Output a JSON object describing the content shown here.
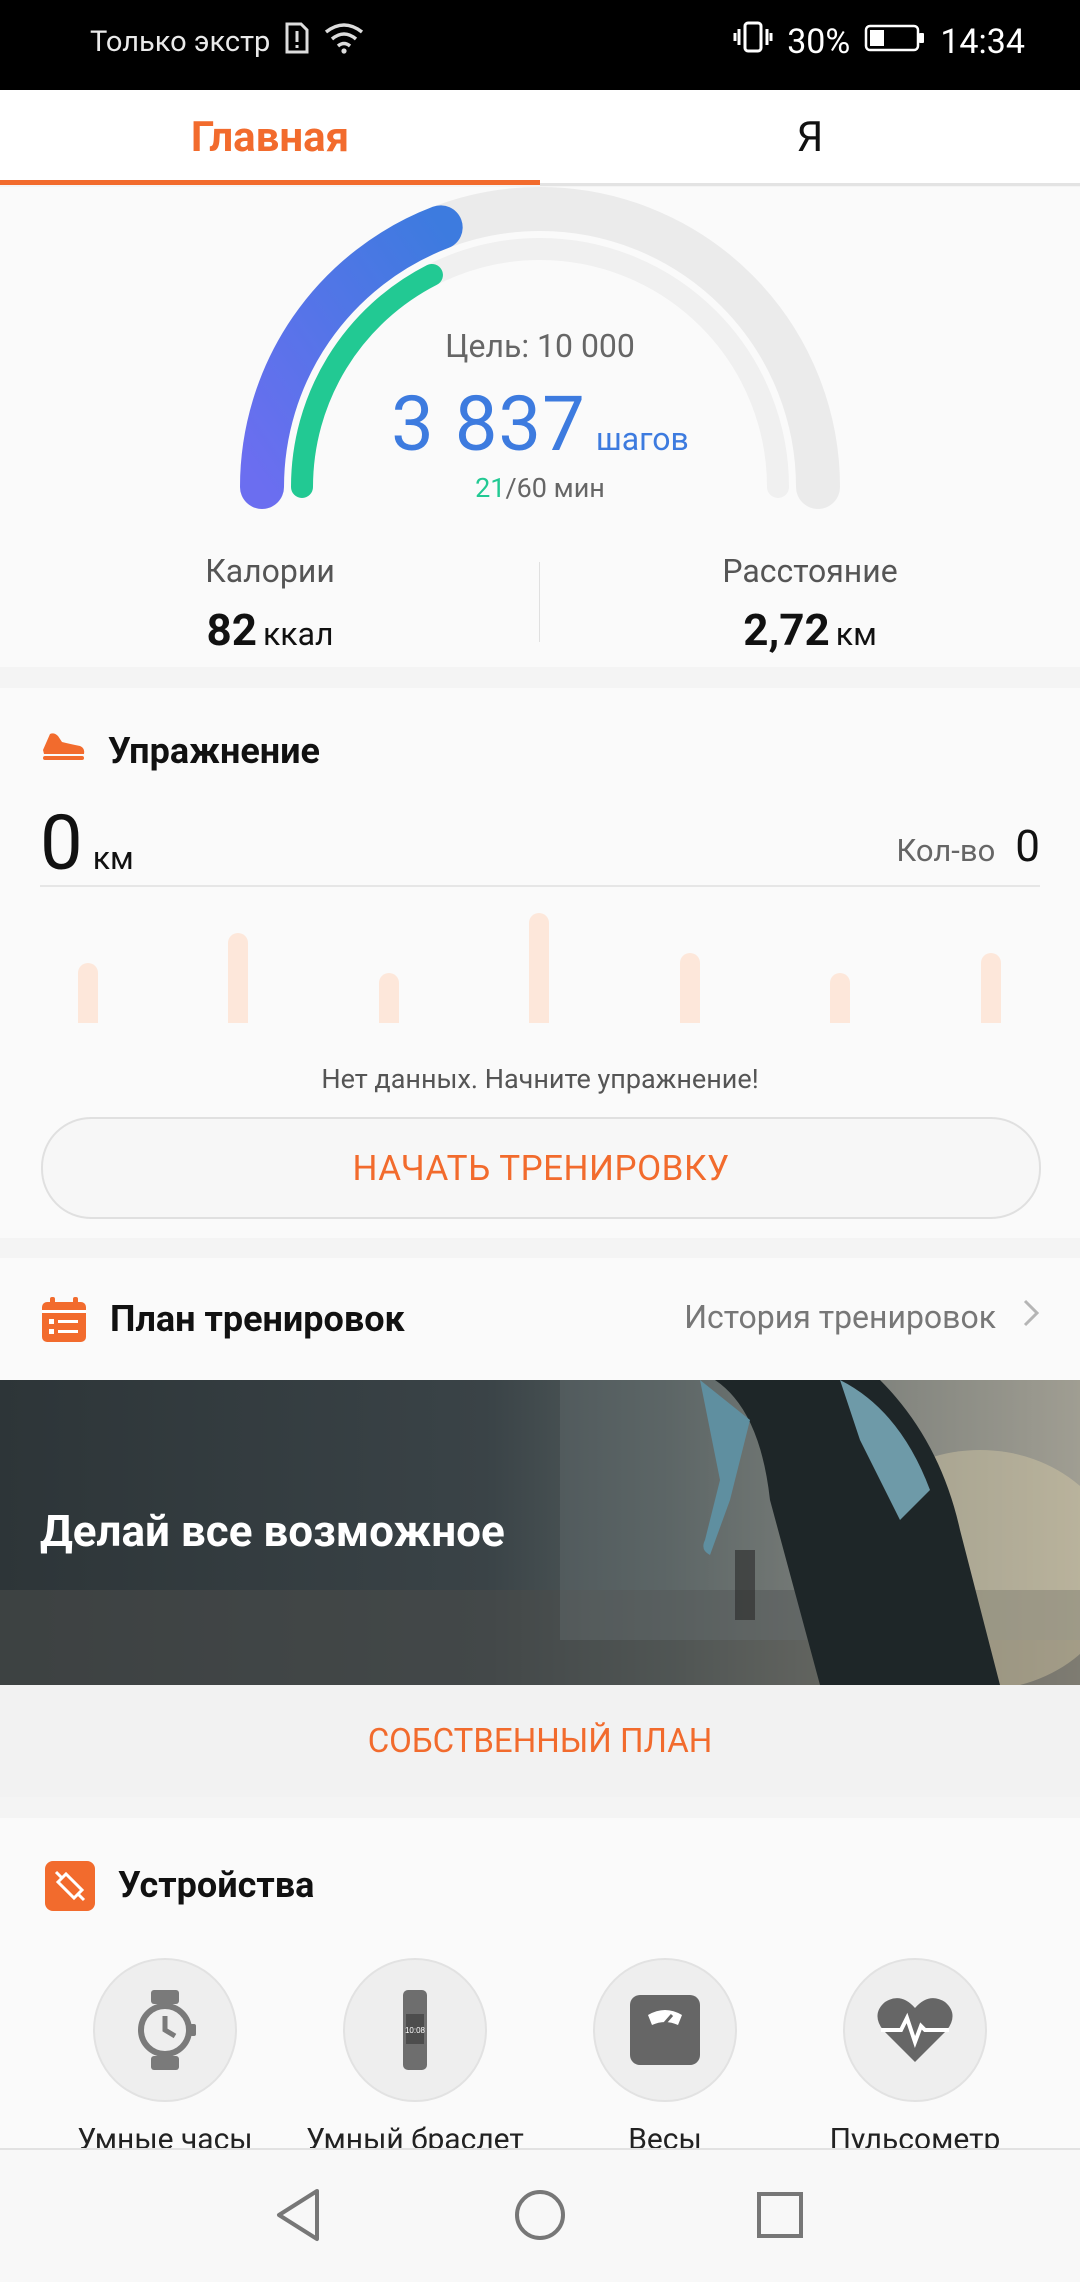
{
  "status_bar": {
    "carrier": "Только экстр",
    "battery_percent": "30%",
    "time": "14:34"
  },
  "tabs": [
    {
      "label": "Главная",
      "active": true
    },
    {
      "label": "Я",
      "active": false
    }
  ],
  "steps": {
    "goal": "Цель: 10 000",
    "count": "3 837",
    "unit": "шагов",
    "active_minutes": "21",
    "minutes_rest": "/60 мин",
    "steps_progress": 0.3837,
    "minutes_progress": 0.35
  },
  "stats": {
    "calories": {
      "label": "Калории",
      "value": "82",
      "unit": "ккал"
    },
    "distance": {
      "label": "Расстояние",
      "value": "2,72",
      "unit": "км"
    }
  },
  "exercise": {
    "title": "Упражнение",
    "distance_value": "0",
    "distance_unit": "км",
    "count_label": "Кол-во",
    "count_value": "0",
    "no_data": "Нет данных. Начните упражнение!",
    "start_button": "НАЧАТЬ ТРЕНИРОВКУ"
  },
  "plan": {
    "title": "План тренировок",
    "history_link": "История тренировок",
    "banner_text": "Делай все возможное",
    "own_plan_button": "СОБСТВЕННЫЙ ПЛАН"
  },
  "devices": {
    "title": "Устройства",
    "items": [
      {
        "label": "Умные часы",
        "icon": "smartwatch-icon"
      },
      {
        "label": "Умный браслет",
        "icon": "fitness-band-icon"
      },
      {
        "label": "Весы",
        "icon": "scale-icon"
      },
      {
        "label": "Пульсометр",
        "icon": "heart-rate-icon"
      }
    ],
    "band_screen_text": "10:08"
  },
  "colors": {
    "accent": "#f26b2d",
    "steps_blue": "#3d7bdf",
    "minutes_green": "#22c993"
  }
}
